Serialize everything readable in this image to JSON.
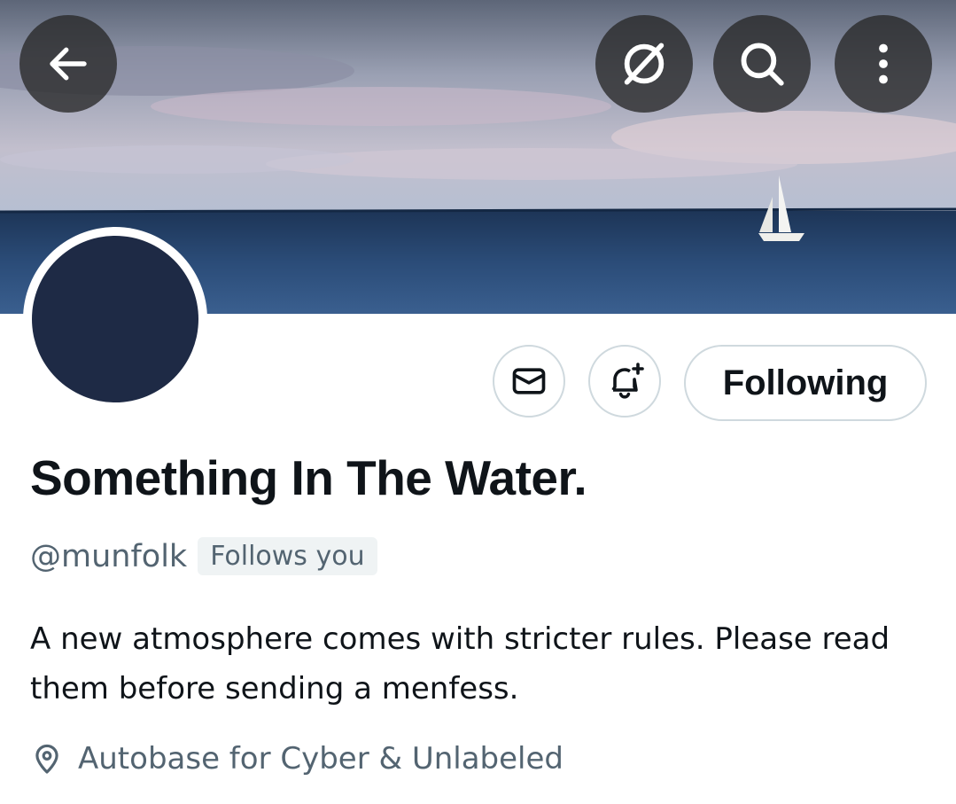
{
  "header": {
    "back_icon": "arrow-left-icon",
    "translate_icon": "translate-icon",
    "search_icon": "search-icon",
    "more_icon": "more-vertical-icon"
  },
  "profile": {
    "display_name": "Something In The Water.",
    "handle": "@munfolk",
    "follows_you_label": "Follows you",
    "bio": "A new atmosphere comes with stricter rules. Please read them before sending a menfess.",
    "location": "Autobase for Cyber & Unlabeled"
  },
  "actions": {
    "message_icon": "mail-icon",
    "notify_icon": "bell-plus-icon",
    "following_label": "Following"
  },
  "colors": {
    "avatar": "#1e2a45",
    "secondary_text": "#536471",
    "primary_text": "#0f1419",
    "border": "#cfd9de"
  }
}
